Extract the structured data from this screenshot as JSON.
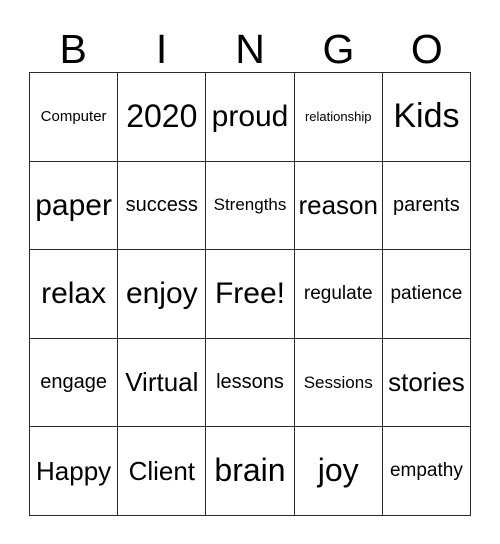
{
  "card": {
    "header_letters": [
      "B",
      "I",
      "N",
      "G",
      "O"
    ],
    "rows": [
      [
        {
          "text": "Computer",
          "size": "fs-tiny"
        },
        {
          "text": "2020",
          "size": "fs-xl"
        },
        {
          "text": "proud",
          "size": "fs-l"
        },
        {
          "text": "relationship",
          "size": "fs-min"
        },
        {
          "text": "Kids",
          "size": "fs-xxl"
        }
      ],
      [
        {
          "text": "paper",
          "size": "fs-l"
        },
        {
          "text": "success",
          "size": "fs-s"
        },
        {
          "text": "Strengths",
          "size": "fs-xxs"
        },
        {
          "text": "reason",
          "size": "fs-m"
        },
        {
          "text": "parents",
          "size": "fs-s"
        }
      ],
      [
        {
          "text": "relax",
          "size": "fs-l"
        },
        {
          "text": "enjoy",
          "size": "fs-l"
        },
        {
          "text": "Free!",
          "size": "fs-l"
        },
        {
          "text": "regulate",
          "size": "fs-xs"
        },
        {
          "text": "patience",
          "size": "fs-xs"
        }
      ],
      [
        {
          "text": "engage",
          "size": "fs-s"
        },
        {
          "text": "Virtual",
          "size": "fs-m"
        },
        {
          "text": "lessons",
          "size": "fs-s"
        },
        {
          "text": "Sessions",
          "size": "fs-xxs"
        },
        {
          "text": "stories",
          "size": "fs-m"
        }
      ],
      [
        {
          "text": "Happy",
          "size": "fs-m"
        },
        {
          "text": "Client",
          "size": "fs-m"
        },
        {
          "text": "brain",
          "size": "fs-xl"
        },
        {
          "text": "joy",
          "size": "fs-xl"
        },
        {
          "text": "empathy",
          "size": "fs-xs"
        }
      ]
    ],
    "free_space": {
      "row": 2,
      "col": 2,
      "label": "Free!"
    },
    "colors": {
      "background": "#ffffff",
      "text": "#000000",
      "border": "#2b2b2b"
    }
  }
}
